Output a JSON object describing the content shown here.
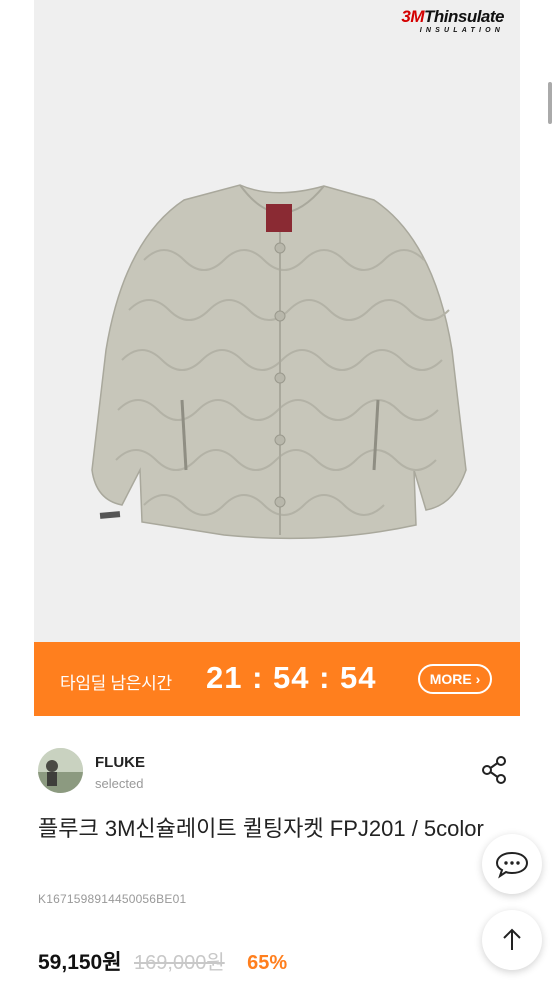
{
  "brand_logo": {
    "mark": "3M",
    "name": "Thinsulate",
    "sub": "INSULATION"
  },
  "deal": {
    "label": "타임딜 남은시간",
    "timer": "21 : 54 : 54",
    "more_label": "MORE"
  },
  "seller": {
    "name": "FLUKE",
    "status": "selected"
  },
  "product": {
    "title": "플루크 3M신슐레이트 퀼팅자켓 FPJ201 / 5color",
    "code": "K1671598914450056BE01",
    "price": "59,150원",
    "original_price": "169,000원",
    "discount": "65%"
  },
  "icons": {
    "share": "share-icon",
    "chat": "chat-bubble-icon",
    "scroll_top": "arrow-up-icon"
  },
  "colors": {
    "accent": "#ff7f1e",
    "image_bg": "#efefef",
    "jacket": "#c7c6ba"
  }
}
